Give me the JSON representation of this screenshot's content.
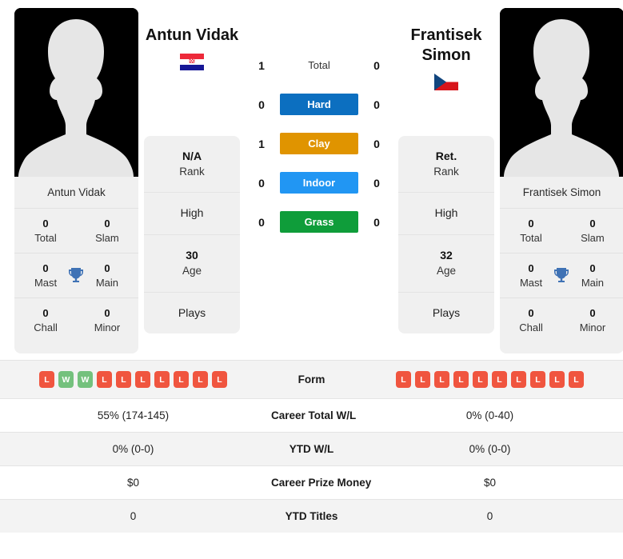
{
  "players": {
    "left": {
      "name": "Antun Vidak",
      "card_name": "Antun Vidak",
      "flag": "croatia-flag",
      "rank": "N/A",
      "rank_label": "Rank",
      "high_label": "High",
      "age": "30",
      "age_label": "Age",
      "plays_label": "Plays",
      "titles": {
        "total_val": "0",
        "total_lbl": "Total",
        "slam_val": "0",
        "slam_lbl": "Slam",
        "mast_val": "0",
        "mast_lbl": "Mast",
        "main_val": "0",
        "main_lbl": "Main",
        "chall_val": "0",
        "chall_lbl": "Chall",
        "minor_val": "0",
        "minor_lbl": "Minor"
      },
      "form": [
        "L",
        "W",
        "W",
        "L",
        "L",
        "L",
        "L",
        "L",
        "L",
        "L"
      ],
      "career_total_wl": "55% (174-145)",
      "ytd_wl": "0% (0-0)",
      "career_prize_money": "$0",
      "ytd_titles": "0"
    },
    "right": {
      "name": "Frantisek Simon",
      "card_name": "Frantisek Simon",
      "flag": "czech-republic-flag",
      "rank": "Ret.",
      "rank_label": "Rank",
      "high_label": "High",
      "age": "32",
      "age_label": "Age",
      "plays_label": "Plays",
      "titles": {
        "total_val": "0",
        "total_lbl": "Total",
        "slam_val": "0",
        "slam_lbl": "Slam",
        "mast_val": "0",
        "mast_lbl": "Mast",
        "main_val": "0",
        "main_lbl": "Main",
        "chall_val": "0",
        "chall_lbl": "Chall",
        "minor_val": "0",
        "minor_lbl": "Minor"
      },
      "form": [
        "L",
        "L",
        "L",
        "L",
        "L",
        "L",
        "L",
        "L",
        "L",
        "L"
      ],
      "career_total_wl": "0% (0-40)",
      "ytd_wl": "0% (0-0)",
      "career_prize_money": "$0",
      "ytd_titles": "0"
    }
  },
  "head_to_head": {
    "rows": [
      {
        "label": "Total",
        "left": "1",
        "right": "0",
        "color": "none",
        "style": "plain"
      },
      {
        "label": "Hard",
        "left": "0",
        "right": "0",
        "color": "#0c6fc0",
        "style": "pill"
      },
      {
        "label": "Clay",
        "left": "1",
        "right": "0",
        "color": "#e09400",
        "style": "pill"
      },
      {
        "label": "Indoor",
        "left": "0",
        "right": "0",
        "color": "#2196f3",
        "style": "pill"
      },
      {
        "label": "Grass",
        "left": "0",
        "right": "0",
        "color": "#0f9d3a",
        "style": "pill"
      }
    ]
  },
  "comparison_table": {
    "rows": [
      {
        "label": "Form",
        "type": "form"
      },
      {
        "label": "Career Total W/L",
        "type": "text",
        "left": "55% (174-145)",
        "right": "0% (0-40)"
      },
      {
        "label": "YTD W/L",
        "type": "text",
        "left": "0% (0-0)",
        "right": "0% (0-0)"
      },
      {
        "label": "Career Prize Money",
        "type": "text",
        "left": "$0",
        "right": "$0"
      },
      {
        "label": "YTD Titles",
        "type": "text",
        "left": "0",
        "right": "0"
      }
    ]
  },
  "colors": {
    "hard": "#0c6fc0",
    "clay": "#e09400",
    "indoor": "#2196f3",
    "grass": "#0f9d3a",
    "win_badge": "#74c17d",
    "loss_badge": "#f0553f",
    "trophy": "#3f72b5",
    "card_bg": "#f0f0f0"
  }
}
